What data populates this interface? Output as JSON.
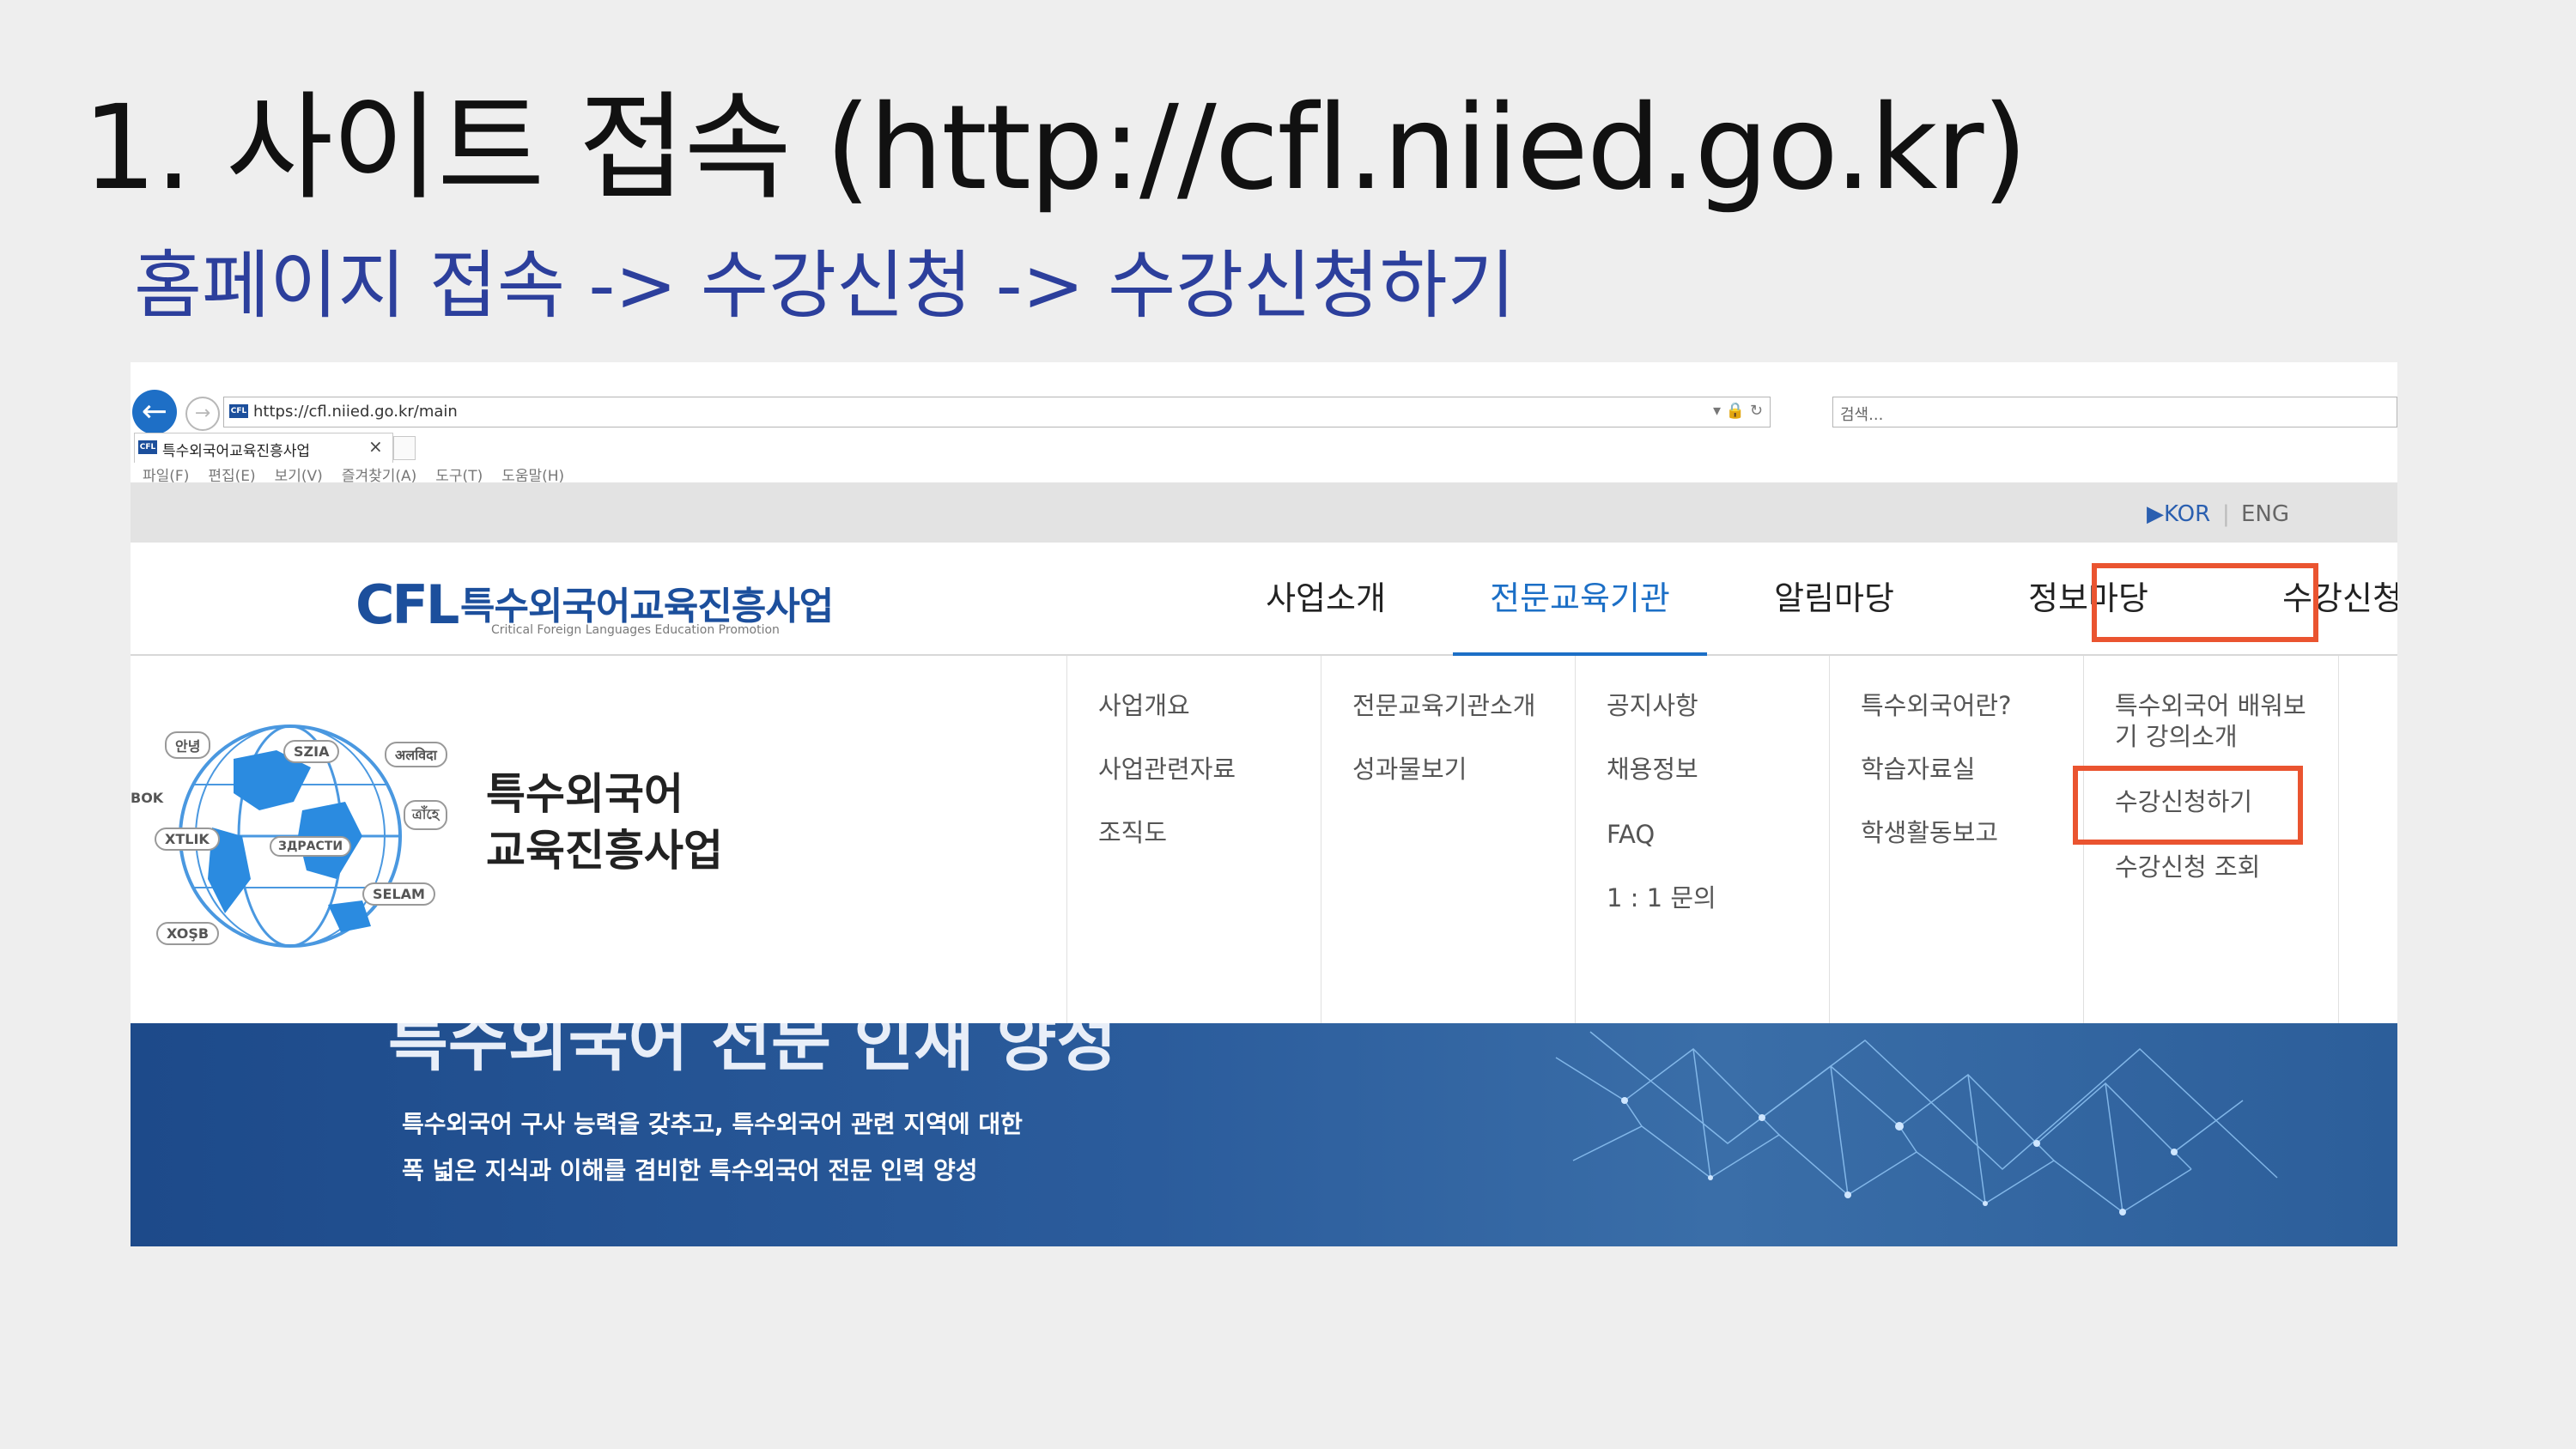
{
  "slide": {
    "title": "1. 사이트 접속 (http://cfl.niied.go.kr)",
    "subtitle": "홈페이지 접속 -> 수강신청 -> 수강신청하기"
  },
  "browser": {
    "url": "https://cfl.niied.go.kr/main",
    "search_placeholder": "검색...",
    "tab_title": "특수외국어교육진흥사업",
    "favicon_text": "CFL",
    "menu": [
      "파일(F)",
      "편집(E)",
      "보기(V)",
      "즐겨찾기(A)",
      "도구(T)",
      "도움말(H)"
    ]
  },
  "site": {
    "lang": {
      "kor": "KOR",
      "eng": "ENG"
    },
    "logo": {
      "mark": "CFL",
      "name": "특수외국어교육진흥사업",
      "sub": "Critical Foreign Languages Education Promotion"
    },
    "nav": [
      "사업소개",
      "전문교육기관",
      "알림마당",
      "정보마당",
      "수강신청"
    ],
    "promo": {
      "line1": "특수외국어",
      "line2": "교육진흥사업"
    },
    "globe_words": [
      "안녕",
      "SZIA",
      "अलविदा",
      "BOK",
      "XTLIK",
      "ЗДРАСТИ",
      "ত্রাঁহে",
      "SELAM",
      "XOŞB"
    ],
    "dropdown": [
      [
        "사업개요",
        "사업관련자료",
        "조직도"
      ],
      [
        "전문교육기관소개",
        "성과물보기"
      ],
      [
        "공지사항",
        "채용정보",
        "FAQ",
        "1 : 1 문의"
      ],
      [
        "특수외국어란?",
        "학습자료실",
        "학생활동보고"
      ],
      [
        "특수외국어 배워보",
        "기 강의소개",
        "수강신청하기",
        "수강신청 조회"
      ]
    ],
    "banner": {
      "title": "특수외국어 전문 인재 양성",
      "line1": "특수외국어 구사 능력을 갖추고, 특수외국어 관련 지역에 대한",
      "line2": "폭 넓은 지식과 이해를 겸비한 특수외국어 전문 인력 양성"
    }
  },
  "colors": {
    "highlight": "#ea5430",
    "brand": "#1c4f9c",
    "active": "#1c6fc6",
    "subtitle": "#2c3f9c"
  }
}
